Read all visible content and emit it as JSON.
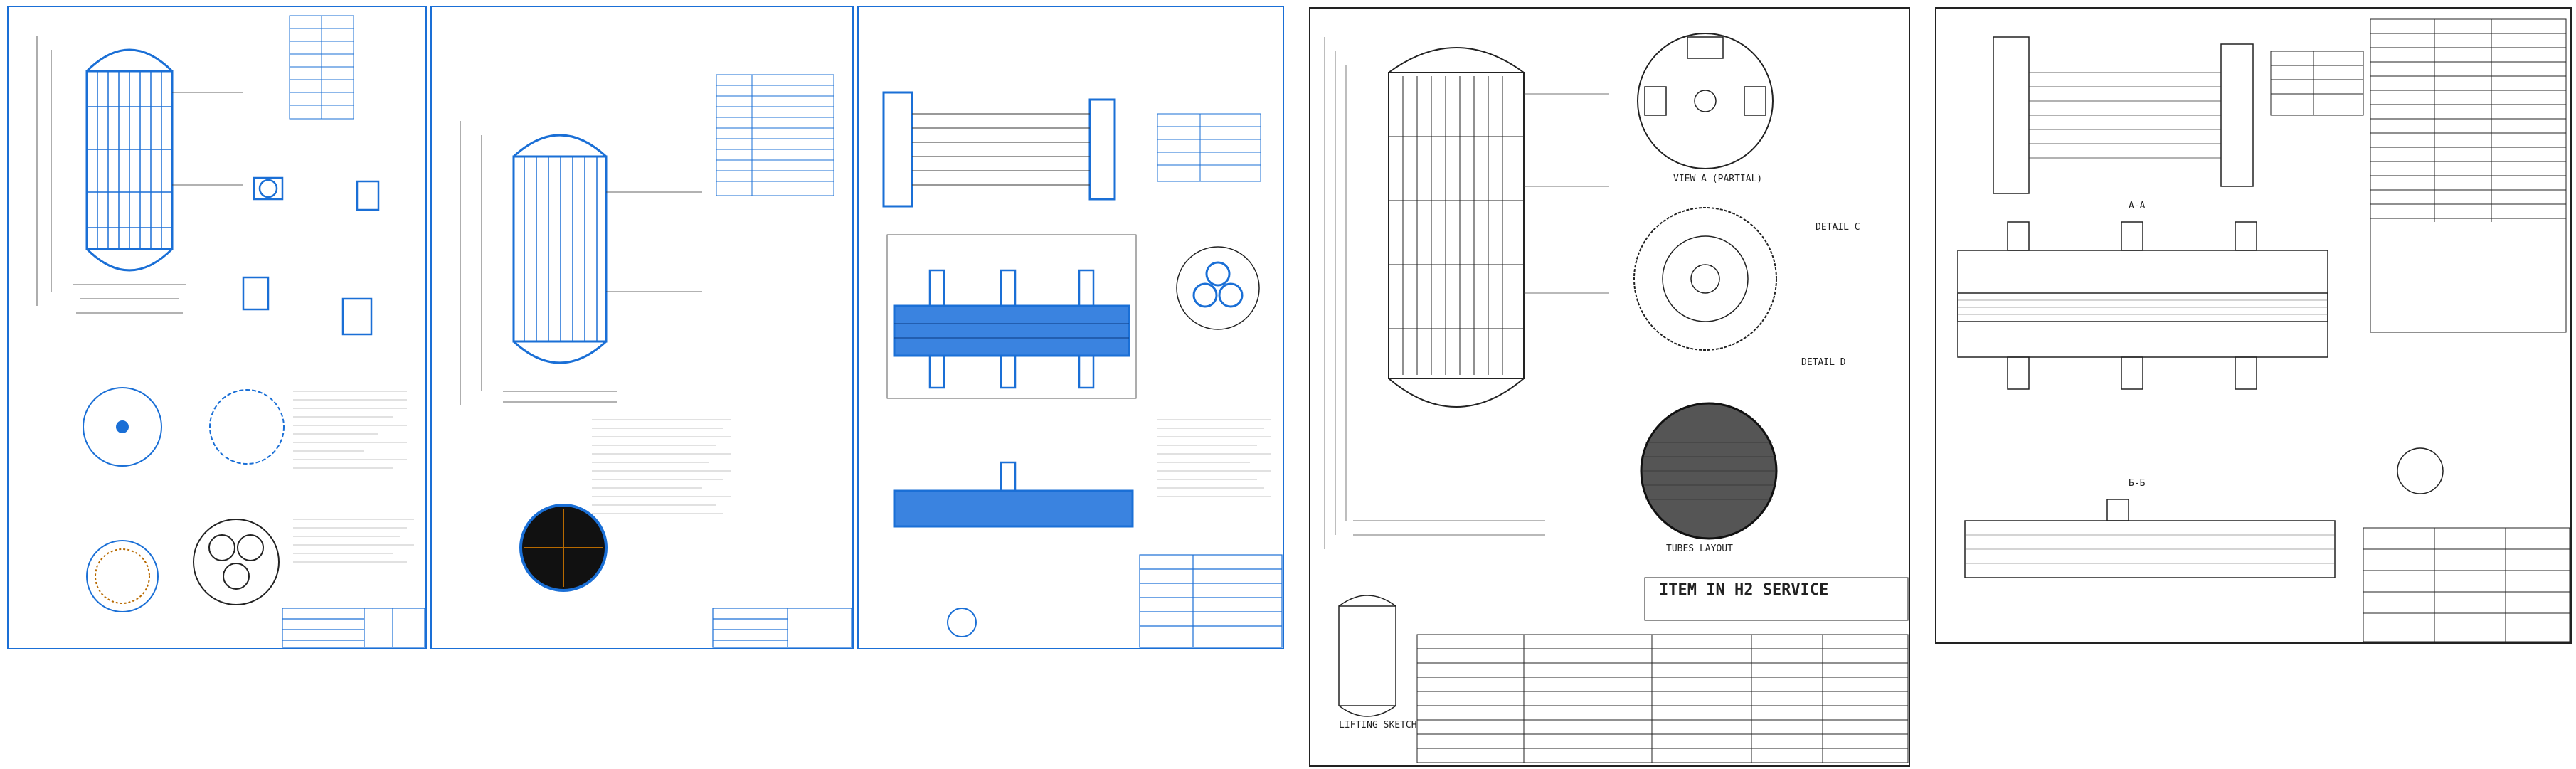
{
  "colors": {
    "blue_line": "#1a6fd6",
    "fill_blue": "#3a83e0",
    "black_line": "#222222",
    "note_text": "#6a8fc4"
  },
  "sheets": [
    {
      "id": "sheet1",
      "style": "blue"
    },
    {
      "id": "sheet2",
      "style": "blue"
    },
    {
      "id": "sheet3",
      "style": "blue"
    },
    {
      "id": "sheet4",
      "style": "black"
    },
    {
      "id": "sheet5",
      "style": "black"
    }
  ],
  "sheet4": {
    "service_title": "ITEM IN H2 SERVICE",
    "detail_c": "DETAIL C",
    "detail_d": "DETAIL D",
    "view_a": "VIEW A (PARTIAL)",
    "lifting_sketch": "LIFTING SKETCH",
    "tubes_layout": "TUBES LAYOUT"
  },
  "sheet5": {
    "section_aa": "A-A",
    "section_bb": "Б-Б"
  }
}
